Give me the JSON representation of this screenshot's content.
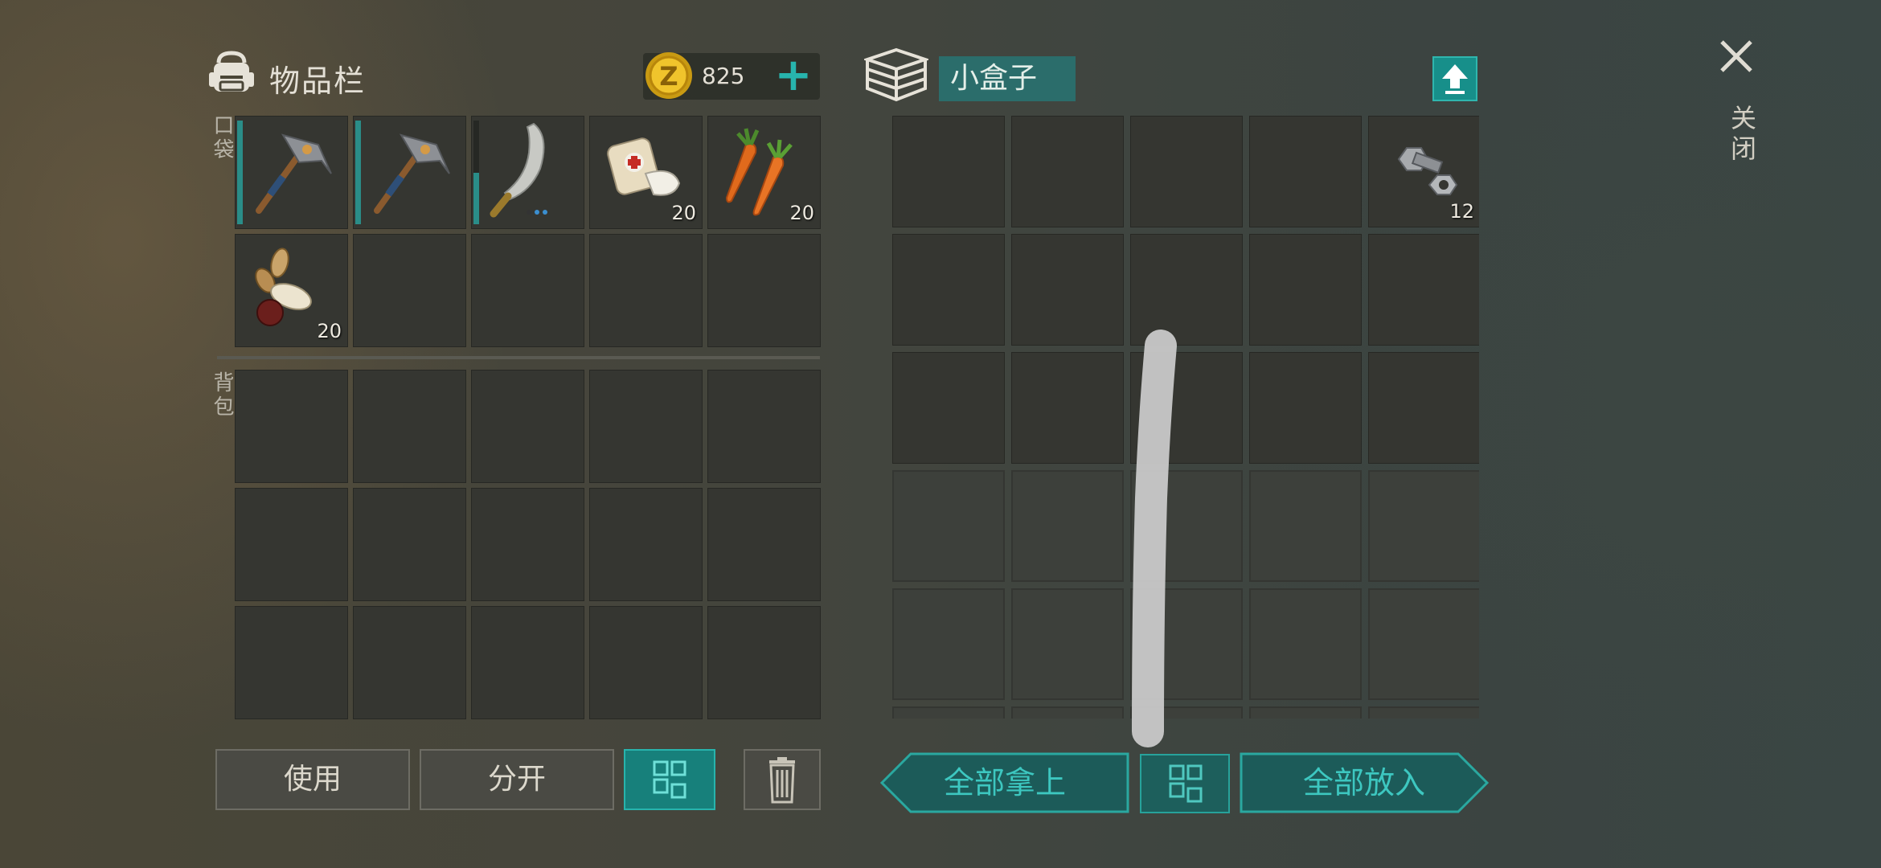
{
  "inventory": {
    "title": "物品栏",
    "coins": "825",
    "pocket_label": "口袋",
    "backpack_label": "背包",
    "pocket_slots": [
      {
        "icon": "pickaxe-icon",
        "durability": 1.0,
        "qty": ""
      },
      {
        "icon": "pickaxe-icon",
        "durability": 1.0,
        "qty": ""
      },
      {
        "icon": "machete-icon",
        "durability": 0.5,
        "qty": ""
      },
      {
        "icon": "bandage-icon",
        "qty": "20"
      },
      {
        "icon": "carrot-icon",
        "qty": "20"
      },
      {
        "icon": "seeds-icon",
        "qty": "20"
      },
      {
        "icon": "",
        "qty": ""
      },
      {
        "icon": "",
        "qty": ""
      },
      {
        "icon": "",
        "qty": ""
      },
      {
        "icon": "",
        "qty": ""
      }
    ],
    "backpack_slot_count": 15
  },
  "container": {
    "title": "小盒子",
    "slots": [
      {
        "icon": "",
        "qty": ""
      },
      {
        "icon": "",
        "qty": ""
      },
      {
        "icon": "",
        "qty": ""
      },
      {
        "icon": "",
        "qty": ""
      },
      {
        "icon": "bolt-nut-icon",
        "qty": "12"
      }
    ],
    "slot_count": 30
  },
  "close": {
    "label": "关闭"
  },
  "buttons": {
    "use": "使用",
    "split": "分开",
    "take_all": "全部拿上",
    "put_all": "全部放入"
  },
  "colors": {
    "accent": "#27b4ad",
    "slot": "#353631",
    "durability": "#2a8d88"
  }
}
